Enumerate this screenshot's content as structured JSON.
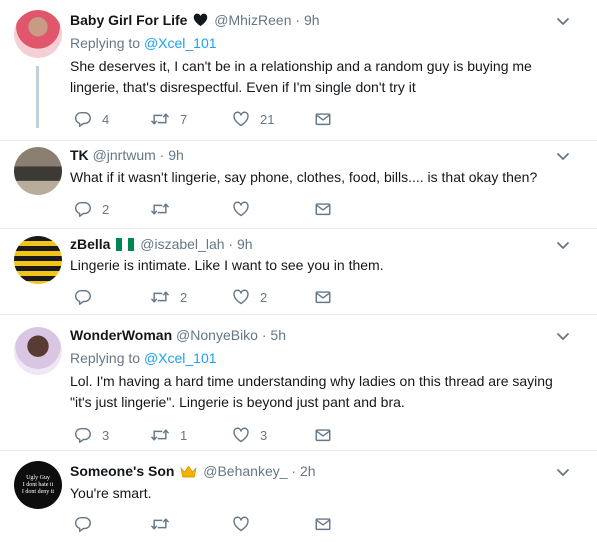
{
  "tweets": [
    {
      "name": "Baby Girl For Life",
      "handle": "@MhizReen",
      "time": "9h",
      "replying_label": "Replying to",
      "replying_to": "@Xcel_101",
      "text": "She deserves it, I can't be in a relationship and a random guy is buying me lingerie, that's disrespectful. Even if I'm single don't try it",
      "replies": "4",
      "retweets": "7",
      "likes": "21",
      "badge": "black-heart-emoji"
    },
    {
      "name": "TK",
      "handle": "@jnrtwum",
      "time": "9h",
      "text": "What if it wasn't lingerie, say phone, clothes, food, bills.... is that okay then?",
      "replies": "2",
      "retweets": "",
      "likes": ""
    },
    {
      "name": "zBella",
      "handle": "@iszabel_lah",
      "time": "9h",
      "text": "Lingerie is intimate. Like I want to see you in them.",
      "replies": "",
      "retweets": "2",
      "likes": "2",
      "badge": "nigeria-flag-emoji"
    },
    {
      "name": "WonderWoman",
      "handle": "@NonyeBiko",
      "time": "5h",
      "replying_label": "Replying to",
      "replying_to": "@Xcel_101",
      "text": "Lol. I'm having a hard time understanding why ladies on this thread are saying \"it's just lingerie\". Lingerie is beyond just pant and bra.",
      "replies": "3",
      "retweets": "1",
      "likes": "3"
    },
    {
      "name": "Someone's Son",
      "handle": "@Behankey_",
      "time": "2h",
      "text": "You're smart.",
      "replies": "",
      "retweets": "",
      "likes": "",
      "badge": "crown-emoji",
      "avatar_text": [
        "Ugly Guy",
        "I dont hate it",
        "I dont deny it"
      ]
    }
  ],
  "dot": "·",
  "colors": {
    "accent": "#1da1f2",
    "muted": "#657786",
    "divider": "#e6ecf0",
    "thread_line": "#c4cfd6"
  }
}
